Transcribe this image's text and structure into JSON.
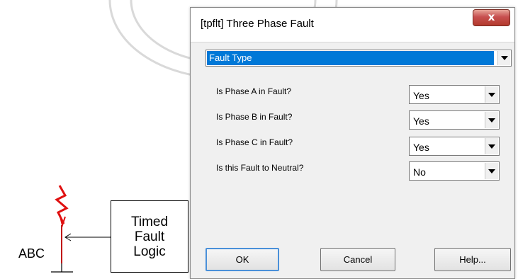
{
  "schematic": {
    "bus_label": "ABC",
    "logic_box_lines": [
      "Timed",
      "Fault",
      "Logic"
    ],
    "fault_color": "#e01010"
  },
  "dialog": {
    "title": "[tpflt] Three Phase Fault",
    "close_label": "x",
    "section_dropdown": {
      "selected": "Fault Type",
      "highlight_color": "#0078d7"
    },
    "questions": [
      {
        "label": "Is Phase A in Fault?",
        "value": "Yes"
      },
      {
        "label": "Is Phase B in Fault?",
        "value": "Yes"
      },
      {
        "label": "Is Phase C in Fault?",
        "value": "Yes"
      },
      {
        "label": "Is this Fault to Neutral?",
        "value": "No"
      }
    ],
    "buttons": {
      "ok": "OK",
      "cancel": "Cancel",
      "help": "Help..."
    }
  }
}
